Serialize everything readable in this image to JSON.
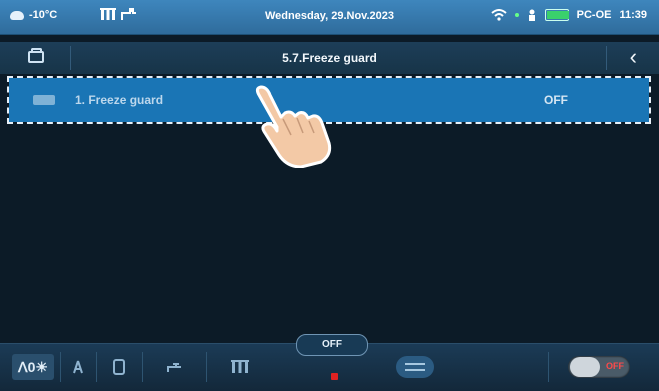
{
  "status_bar": {
    "outdoor_temp": "-10°C",
    "date": "Wednesday, 29.Nov.2023",
    "device": "PC-OE",
    "time": "11:39",
    "battery_badge": "100"
  },
  "header": {
    "title": "5.7.Freeze guard",
    "folder_icon": "folder-icon",
    "back_icon": "chevron-left-icon"
  },
  "list": {
    "items": [
      {
        "label": "1. Freeze guard",
        "value": "OFF"
      }
    ]
  },
  "bottom_bar": {
    "mode_label": "ꓥ0☀",
    "off_tab": "OFF",
    "power_state": "OFF"
  },
  "colors": {
    "accent": "#1a75b5",
    "statusbar": "#3e86bd",
    "background": "#0c1b27",
    "off_red": "#e02222"
  }
}
